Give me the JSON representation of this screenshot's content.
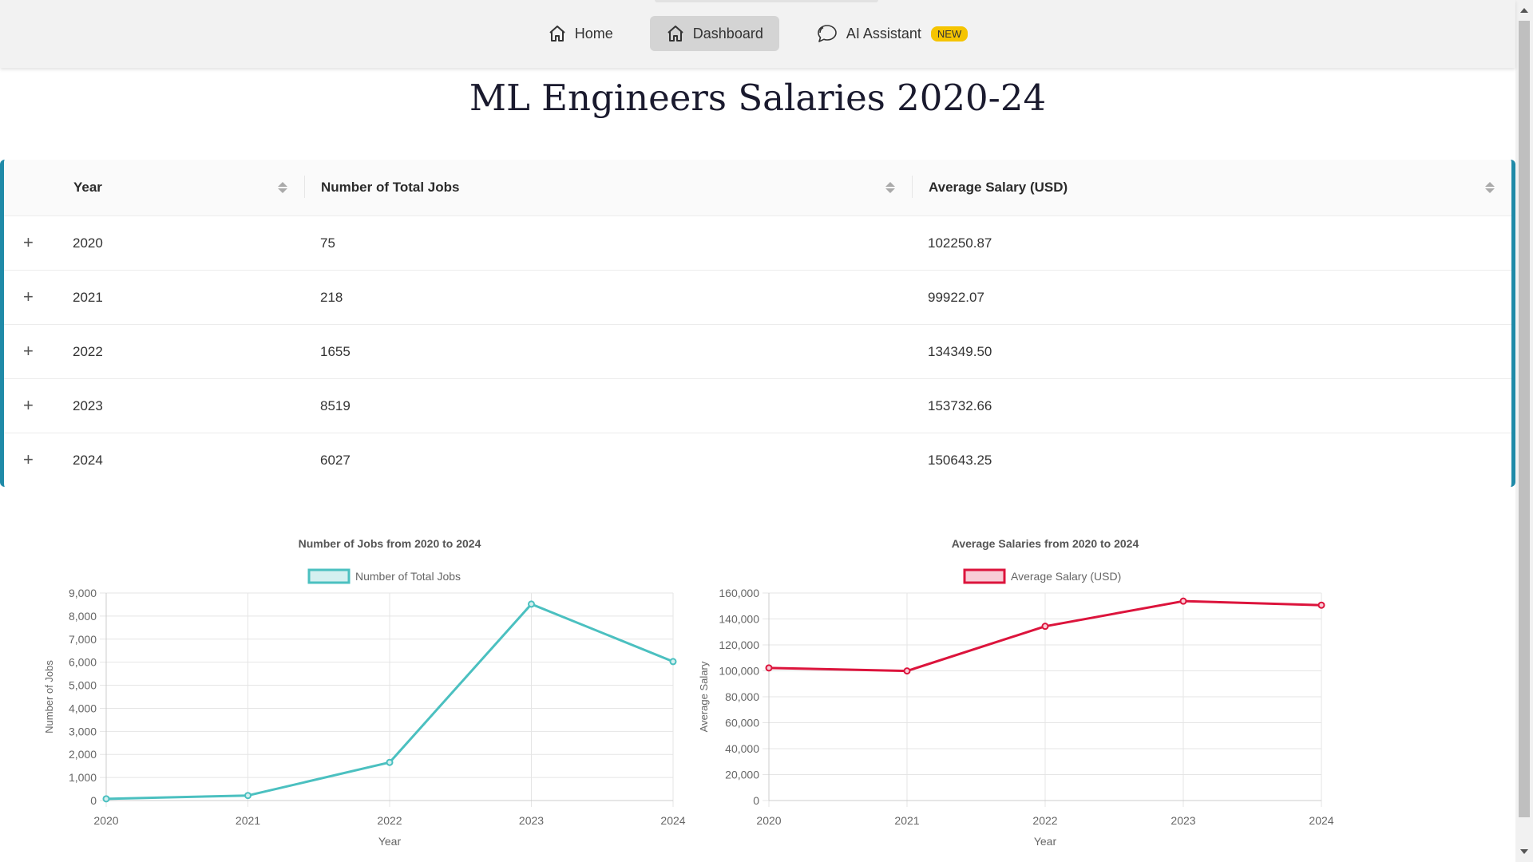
{
  "nav": {
    "items": [
      {
        "label": "Home",
        "icon": "home-icon",
        "active": false
      },
      {
        "label": "Dashboard",
        "icon": "home-icon",
        "active": true
      },
      {
        "label": "AI Assistant",
        "icon": "chat-icon",
        "active": false,
        "badge": "NEW"
      }
    ]
  },
  "page": {
    "title": "ML Engineers Salaries 2020-24"
  },
  "table": {
    "columns": [
      "Year",
      "Number of Total Jobs",
      "Average Salary (USD)"
    ],
    "rows": [
      {
        "year": "2020",
        "jobs": "75",
        "salary": "102250.87"
      },
      {
        "year": "2021",
        "jobs": "218",
        "salary": "99922.07"
      },
      {
        "year": "2022",
        "jobs": "1655",
        "salary": "134349.50"
      },
      {
        "year": "2023",
        "jobs": "8519",
        "salary": "153732.66"
      },
      {
        "year": "2024",
        "jobs": "6027",
        "salary": "150643.25"
      }
    ],
    "expand_glyph": "+"
  },
  "colors": {
    "accent": "#1f8aa8",
    "jobs_line": "#4bc0c0",
    "salary_line": "#dc143c"
  },
  "chart_data": [
    {
      "type": "line",
      "title": "Number of Jobs from 2020 to 2024",
      "x": [
        "2020",
        "2021",
        "2022",
        "2023",
        "2024"
      ],
      "series": [
        {
          "name": "Number of Total Jobs",
          "values": [
            75,
            218,
            1655,
            8519,
            6027
          ]
        }
      ],
      "xlabel": "Year",
      "ylabel": "Number of Jobs",
      "ylim": [
        0,
        9000
      ],
      "yticks": [
        0,
        1000,
        2000,
        3000,
        4000,
        5000,
        6000,
        7000,
        8000,
        9000
      ],
      "yticklabels": [
        "0",
        "1,000",
        "2,000",
        "3,000",
        "4,000",
        "5,000",
        "6,000",
        "7,000",
        "8,000",
        "9,000"
      ],
      "legend": "top",
      "grid": true
    },
    {
      "type": "line",
      "title": "Average Salaries from 2020 to 2024",
      "x": [
        "2020",
        "2021",
        "2022",
        "2023",
        "2024"
      ],
      "series": [
        {
          "name": "Average Salary (USD)",
          "values": [
            102250.87,
            99922.07,
            134349.5,
            153732.66,
            150643.25
          ]
        }
      ],
      "xlabel": "Year",
      "ylabel": "Average Salary",
      "ylim": [
        0,
        160000
      ],
      "yticks": [
        0,
        20000,
        40000,
        60000,
        80000,
        100000,
        120000,
        140000,
        160000
      ],
      "yticklabels": [
        "0",
        "20,000",
        "40,000",
        "60,000",
        "80,000",
        "100,000",
        "120,000",
        "140,000",
        "160,000"
      ],
      "legend": "top",
      "grid": true
    }
  ]
}
